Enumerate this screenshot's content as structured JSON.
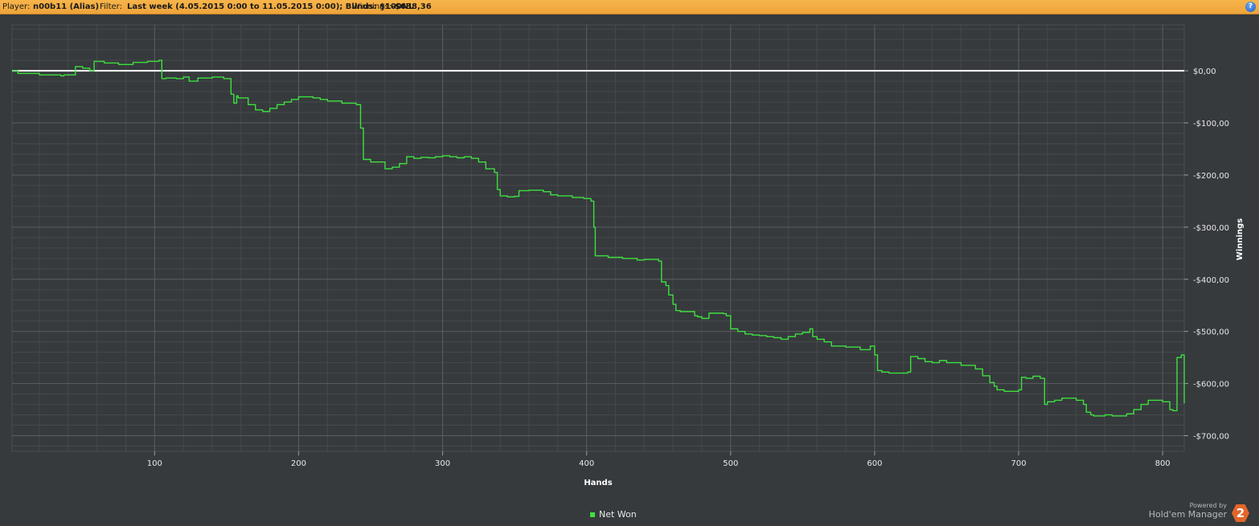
{
  "header": {
    "player_label": "Player:",
    "player_value": "n00b11 (Alias)",
    "filter_label": "Filter:",
    "filter_value": "Last week (4.05.2015 0:00 to 11.05.2015 0:00); Blinds: $100NL",
    "winnings_label": "Winnings:",
    "winnings_value": "-$638,36",
    "help_label": "?"
  },
  "legend": {
    "label": "Net Won"
  },
  "branding": {
    "powered_by": "Powered by",
    "product": "Hold'em Manager",
    "logo_glyph": "2"
  },
  "colors": {
    "series": "#3ee03e",
    "zero_line": "#ffffff",
    "grid": "#5a5e61",
    "background": "#363a3d"
  },
  "chart_data": {
    "type": "line",
    "title": "",
    "xlabel": "Hands",
    "ylabel": "Winnings",
    "xlim": [
      1,
      815
    ],
    "ylim": [
      -730,
      88
    ],
    "x_ticks": [
      100,
      200,
      300,
      400,
      500,
      600,
      700,
      800
    ],
    "y_ticks": [
      0,
      -100,
      -200,
      -300,
      -400,
      -500,
      -600,
      -700
    ],
    "y_tick_labels": [
      "$0,00",
      "-$100,00",
      "-$200,00",
      "-$300,00",
      "-$400,00",
      "-$500,00",
      "-$600,00",
      "-$700,00"
    ],
    "reference_line": 0,
    "grid": true,
    "legend_position": "bottom-center",
    "series": [
      {
        "name": "Net Won",
        "x": [
          1,
          5,
          20,
          35,
          37,
          45,
          50,
          55,
          58,
          65,
          75,
          85,
          95,
          103,
          105,
          108,
          115,
          120,
          124,
          130,
          140,
          148,
          153,
          155,
          157,
          158,
          165,
          170,
          175,
          180,
          185,
          190,
          195,
          200,
          210,
          215,
          220,
          230,
          240,
          243,
          245,
          250,
          260,
          265,
          270,
          275,
          280,
          285,
          290,
          295,
          300,
          305,
          310,
          315,
          320,
          325,
          330,
          336,
          338,
          340,
          345,
          350,
          353,
          360,
          370,
          375,
          380,
          390,
          398,
          403,
          405,
          406,
          415,
          425,
          435,
          440,
          450,
          452,
          455,
          457,
          460,
          462,
          465,
          468,
          475,
          477,
          480,
          485,
          495,
          497,
          500,
          505,
          510,
          515,
          520,
          525,
          530,
          535,
          540,
          545,
          550,
          555,
          557,
          560,
          565,
          570,
          580,
          590,
          597,
          600,
          602,
          605,
          610,
          620,
          623,
          625,
          630,
          635,
          640,
          645,
          650,
          660,
          670,
          675,
          680,
          683,
          685,
          690,
          700,
          702,
          705,
          710,
          715,
          718,
          720,
          725,
          730,
          740,
          745,
          747,
          750,
          752,
          755,
          760,
          765,
          770,
          775,
          780,
          785,
          790,
          800,
          805,
          807,
          810,
          813,
          815
        ],
        "y": [
          0,
          -5,
          -8,
          -10,
          -8,
          8,
          5,
          0,
          18,
          15,
          12,
          16,
          18,
          20,
          -15,
          -14,
          -15,
          -12,
          -20,
          -14,
          -12,
          -15,
          -45,
          -62,
          -48,
          -52,
          -65,
          -75,
          -78,
          -72,
          -65,
          -60,
          -55,
          -50,
          -52,
          -55,
          -58,
          -62,
          -65,
          -110,
          -170,
          -175,
          -188,
          -185,
          -178,
          -165,
          -168,
          -166,
          -167,
          -165,
          -163,
          -165,
          -167,
          -165,
          -168,
          -175,
          -188,
          -195,
          -228,
          -240,
          -242,
          -241,
          -230,
          -229,
          -232,
          -238,
          -240,
          -243,
          -245,
          -250,
          -300,
          -355,
          -358,
          -360,
          -363,
          -362,
          -365,
          -405,
          -412,
          -430,
          -448,
          -460,
          -462,
          -462,
          -470,
          -472,
          -475,
          -465,
          -466,
          -470,
          -495,
          -500,
          -505,
          -507,
          -508,
          -510,
          -512,
          -515,
          -510,
          -505,
          -502,
          -495,
          -510,
          -515,
          -520,
          -528,
          -530,
          -535,
          -528,
          -545,
          -575,
          -578,
          -580,
          -580,
          -578,
          -548,
          -552,
          -558,
          -560,
          -556,
          -560,
          -565,
          -572,
          -585,
          -598,
          -605,
          -612,
          -615,
          -612,
          -588,
          -590,
          -586,
          -590,
          -640,
          -635,
          -632,
          -628,
          -632,
          -640,
          -655,
          -660,
          -662,
          -662,
          -660,
          -662,
          -662,
          -658,
          -650,
          -640,
          -632,
          -635,
          -650,
          -652,
          -550,
          -545,
          -638
        ]
      }
    ]
  }
}
